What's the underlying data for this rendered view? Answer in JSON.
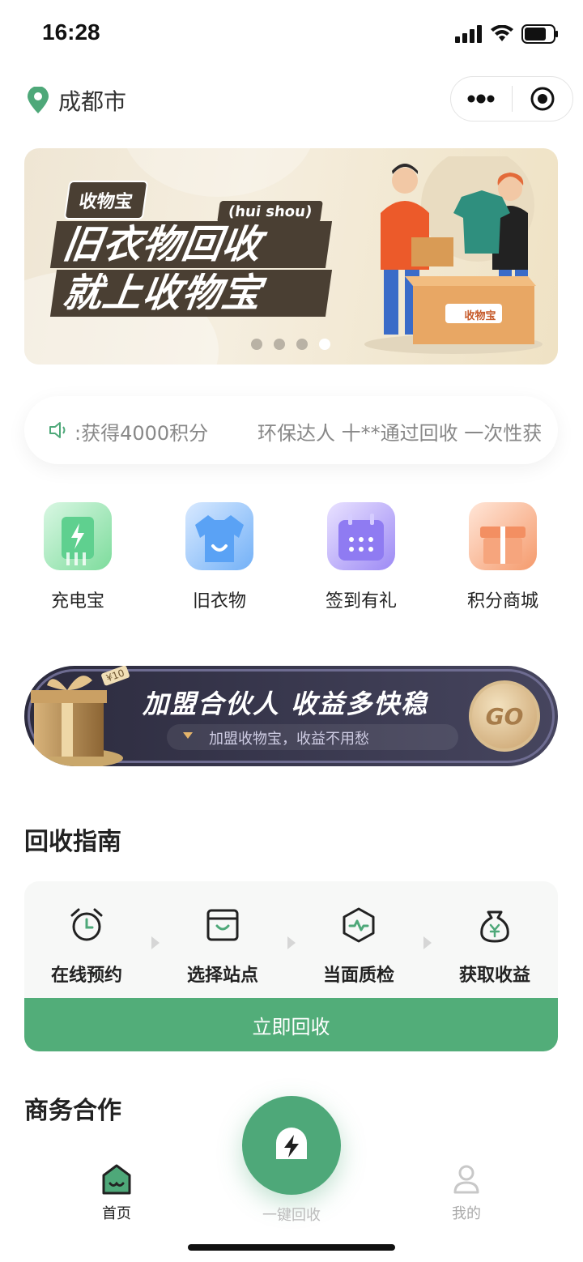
{
  "status_bar": {
    "time": "16:28"
  },
  "header": {
    "city": "成都市"
  },
  "banner": {
    "brand": "收物宝",
    "pinyin": "(hui shou)",
    "headline_line1": "旧衣物回收",
    "headline_line2": "就上收物宝",
    "box_label": "收物宝",
    "slide_count": 4,
    "active_slide": 4
  },
  "notice": {
    "text_1": ":获得4000积分",
    "text_2": "环保达人 十**通过回收 一次性获"
  },
  "quick_menu": [
    {
      "label": "充电宝",
      "icon": "power-bank-icon",
      "color": "#5fd08f"
    },
    {
      "label": "旧衣物",
      "icon": "clothes-icon",
      "color": "#5aa2f5"
    },
    {
      "label": "签到有礼",
      "icon": "calendar-icon",
      "color": "#8f7bf2"
    },
    {
      "label": "积分商城",
      "icon": "gift-icon",
      "color": "#f38f62"
    }
  ],
  "partner_banner": {
    "title": "加盟合伙人 收益多快稳",
    "subtitle": "加盟收物宝，收益不用愁",
    "go": "GO",
    "gift_tag": "¥10"
  },
  "guide": {
    "title": "回收指南",
    "steps": [
      {
        "label": "在线预约",
        "icon": "alarm-clock-icon"
      },
      {
        "label": "选择站点",
        "icon": "store-icon"
      },
      {
        "label": "当面质检",
        "icon": "inspection-icon"
      },
      {
        "label": "获取收益",
        "icon": "money-bag-icon"
      }
    ],
    "button": "立即回收"
  },
  "business": {
    "title": "商务合作"
  },
  "tabbar": {
    "home": "首页",
    "center": "一键回收",
    "mine": "我的"
  },
  "colors": {
    "primary": "#52ad79",
    "banner_dark": "#4a3f33"
  }
}
